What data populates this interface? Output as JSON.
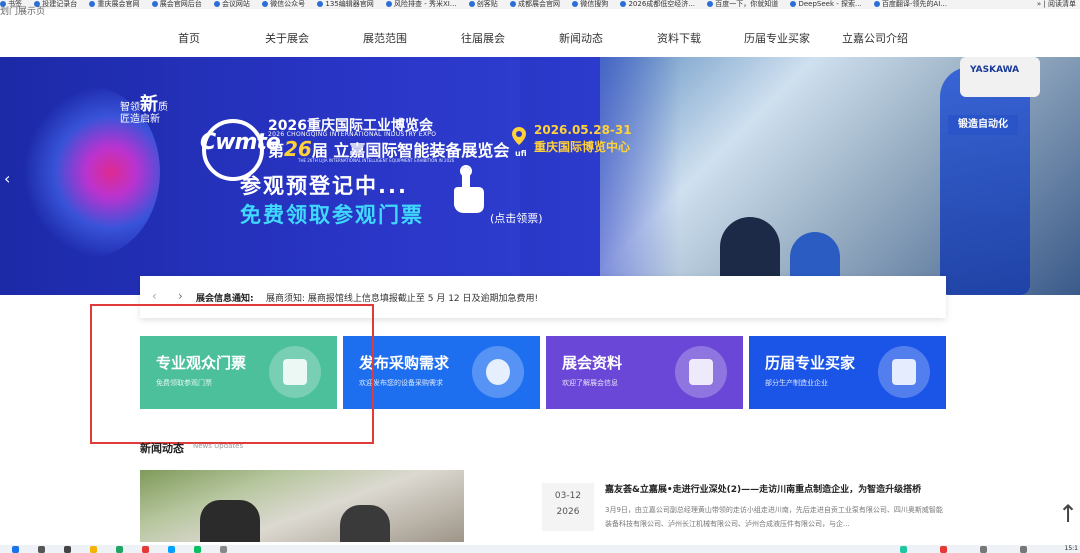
{
  "bookmarks": [
    "书签",
    "投建记录台",
    "重庆展会官网",
    "展会官网后台",
    "会议网站",
    "微信公众号",
    "135编辑器官网",
    "风险排查 - 秀米XI...",
    "创客贴",
    "成都展会官网",
    "微信搜狗",
    "2026成都低空经济...",
    "百度一下，你就知道",
    "DeepSeek - 探索...",
    "百度翻译-领先的AI..."
  ],
  "bookmarks_right": "» | 阅读清单",
  "cut_text": "划门展示页",
  "nav": [
    "首页",
    "关于展会",
    "展范范围",
    "往届展会",
    "新闻动态",
    "资料下载",
    "历届专业买家",
    "立嘉公司介绍"
  ],
  "banner": {
    "slogan_a": "智领",
    "slogan_b": "新",
    "slogan_c": "质",
    "slogan_d": "匠造启新",
    "logo": "Cwmte",
    "title1": "2026重庆国际工业博览会",
    "title1_en": "2026 CHONGQING INTERNATIONAL INDUSTRY EXPO",
    "title2_pre": "第",
    "title2_num": "26",
    "title2_post": "届 立嘉国际智能装备展览会",
    "ufi": "ufi",
    "title2_en": "THE 26TH LIJIA INTERNATIONAL INTELLIGENT EQUIPMENT EXHIBITION IN 2026",
    "date": "2026.05.28-31",
    "venue": "重庆国际博览中心",
    "register": "参观预登记中...",
    "free": "免费领取参观门票",
    "click_label": "(点击领票)",
    "yaskawa": "YASKAWA",
    "sign": "锻造自动化",
    "prev_arrow": "‹"
  },
  "notice": {
    "prev": "‹",
    "next": "›",
    "label": "展会信息通知:",
    "text": "展商须知: 展商报馆线上信息填报截止至 5 月 12 日及逾期加急费用!"
  },
  "cards": [
    {
      "title": "专业观众门票",
      "subtitle": "免费领取参观门票",
      "color": "#4cbf9b"
    },
    {
      "title": "发布采购需求",
      "subtitle": "欢迎发布您的设备采购需求",
      "color": "#1e6ff0"
    },
    {
      "title": "展会资料",
      "subtitle": "欢迎了解展会信息",
      "color": "#6a47d6"
    },
    {
      "title": "历届专业买家",
      "subtitle": "部分生产制造业企业",
      "color": "#1a55e8"
    }
  ],
  "news": {
    "title": "新闻动态",
    "subtitle": "News Updates",
    "date_md": "03-12",
    "date_yr": "2026",
    "headline": "嘉友荟&立嘉展•走进行业深处(2)——走访川南重点制造企业，为智造升级搭桥",
    "excerpt": "3月9日，由立嘉公司副总经理黄山带领的走访小组走进川南，先后走进自贡工业泵有限公司、四川奥斯威智能装备科技有限公司、泸州长江机械有限公司、泸州合成液压件有限公司，与企..."
  },
  "top_button": "↑",
  "taskbar_time": "15:1"
}
